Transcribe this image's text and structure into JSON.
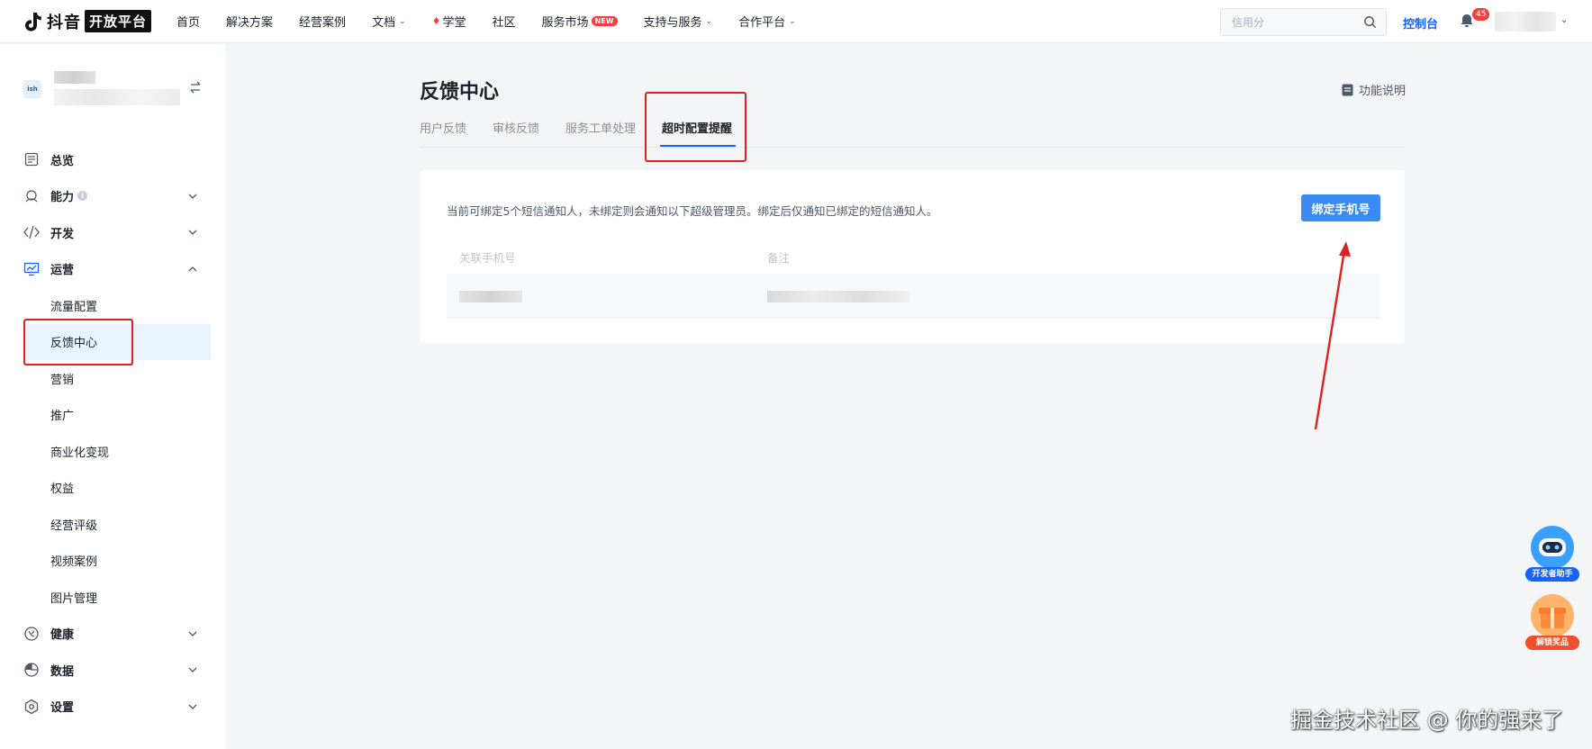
{
  "header": {
    "logo_text": "抖音",
    "logo_box": "开放平台",
    "nav": [
      {
        "label": "首页",
        "caret": false
      },
      {
        "label": "解决方案",
        "caret": false
      },
      {
        "label": "经营案例",
        "caret": false
      },
      {
        "label": "文档",
        "caret": true
      },
      {
        "label": "学堂",
        "caret": false,
        "flame": true
      },
      {
        "label": "社区",
        "caret": false
      },
      {
        "label": "服务市场",
        "caret": false,
        "badge": "NEW"
      },
      {
        "label": "支持与服务",
        "caret": true
      },
      {
        "label": "合作平台",
        "caret": true
      }
    ],
    "search_placeholder": "信用分",
    "console_label": "控制台",
    "notification_count": "45"
  },
  "sidebar": {
    "app_avatar_text": "ish",
    "menu": [
      {
        "label": "总览",
        "icon": "overview-icon",
        "expandable": false
      },
      {
        "label": "能力",
        "icon": "ability-icon",
        "expandable": true,
        "info": "i"
      },
      {
        "label": "开发",
        "icon": "code-icon",
        "expandable": true
      },
      {
        "label": "运营",
        "icon": "operation-icon",
        "expandable": true,
        "expanded": true
      }
    ],
    "submenu": [
      {
        "label": "流量配置"
      },
      {
        "label": "反馈中心",
        "active": true
      },
      {
        "label": "营销"
      },
      {
        "label": "推广"
      },
      {
        "label": "商业化变现"
      },
      {
        "label": "权益"
      },
      {
        "label": "经营评级"
      },
      {
        "label": "视频案例"
      },
      {
        "label": "图片管理"
      }
    ],
    "menu_bottom": [
      {
        "label": "健康",
        "icon": "health-icon"
      },
      {
        "label": "数据",
        "icon": "data-icon"
      },
      {
        "label": "设置",
        "icon": "settings-icon"
      }
    ]
  },
  "main": {
    "title": "反馈中心",
    "help_label": "功能说明",
    "tabs": [
      {
        "label": "用户反馈"
      },
      {
        "label": "审核反馈"
      },
      {
        "label": "服务工单处理"
      },
      {
        "label": "超时配置提醒",
        "active": true
      }
    ],
    "notice": "当前可绑定5个短信通知人，未绑定则会通知以下超级管理员。绑定后仅通知已绑定的短信通知人。",
    "bind_button": "绑定手机号",
    "table_headers": [
      "关联手机号",
      "备注"
    ]
  },
  "floating": {
    "assistant_label": "开发者助手",
    "reward_label": "解锁奖品"
  },
  "watermark": "掘金技术社区 @ 你的强来了",
  "colors": {
    "accent": "#1664ff",
    "button": "#3c8bf5",
    "highlight_box": "#e02020",
    "active_menu_bg": "#e8f3ff"
  }
}
